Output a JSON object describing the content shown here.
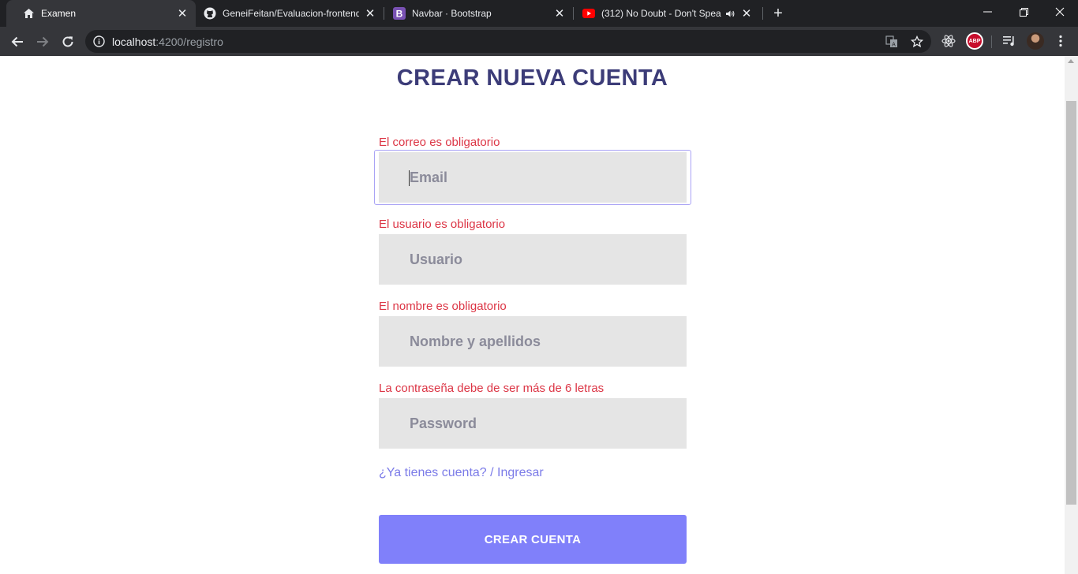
{
  "browser": {
    "tabs": [
      {
        "title": "Examen",
        "icon": "home-icon",
        "active": true
      },
      {
        "title": "GeneiFeitan/Evaluacion-frontend",
        "icon": "github-icon",
        "active": false
      },
      {
        "title": "Navbar · Bootstrap",
        "icon": "bootstrap-icon",
        "active": false
      },
      {
        "title": "(312) No Doubt - Don't Spea",
        "icon": "youtube-icon",
        "active": false,
        "audio": true
      }
    ],
    "new_tab": "+",
    "address": {
      "host": "localhost",
      "path": ":4200/registro"
    },
    "extension_abp": "ABP",
    "colors": {
      "chrome_dark": "#202124",
      "chrome_toolbar": "#35363a"
    }
  },
  "page": {
    "title": "CREAR NUEVA CUENTA",
    "fields": {
      "email": {
        "error": "El correo es obligatorio",
        "placeholder": "Email",
        "value": ""
      },
      "usuario": {
        "error": "El usuario es obligatorio",
        "placeholder": "Usuario",
        "value": ""
      },
      "nombre": {
        "error": "El nombre es obligatorio",
        "placeholder": "Nombre y apellidos",
        "value": ""
      },
      "password": {
        "error": "La contraseña debe de ser más de 6 letras",
        "placeholder": "Password",
        "value": ""
      }
    },
    "login_link": "¿Ya tienes cuenta? / Ingresar",
    "submit_label": "CREAR CUENTA",
    "colors": {
      "title": "#3c3c78",
      "error": "#dc3545",
      "link": "#7b7be8",
      "button": "#8080fa",
      "field_bg": "#e5e5e5"
    }
  }
}
